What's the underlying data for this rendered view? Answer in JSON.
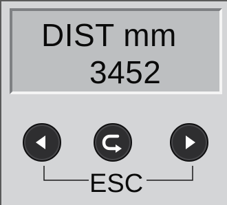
{
  "display": {
    "line1": "DIST mm",
    "line2": "3452"
  },
  "controls": {
    "left_button_icon": "left-arrow-icon",
    "center_button_icon": "return-arrow-icon",
    "right_button_icon": "right-arrow-icon",
    "esc_label": "ESC"
  },
  "colors": {
    "panel": "#d4d5d7",
    "lcd_background": "#bdbfc1",
    "button": "#2e2e30",
    "icon": "#ffffff"
  }
}
